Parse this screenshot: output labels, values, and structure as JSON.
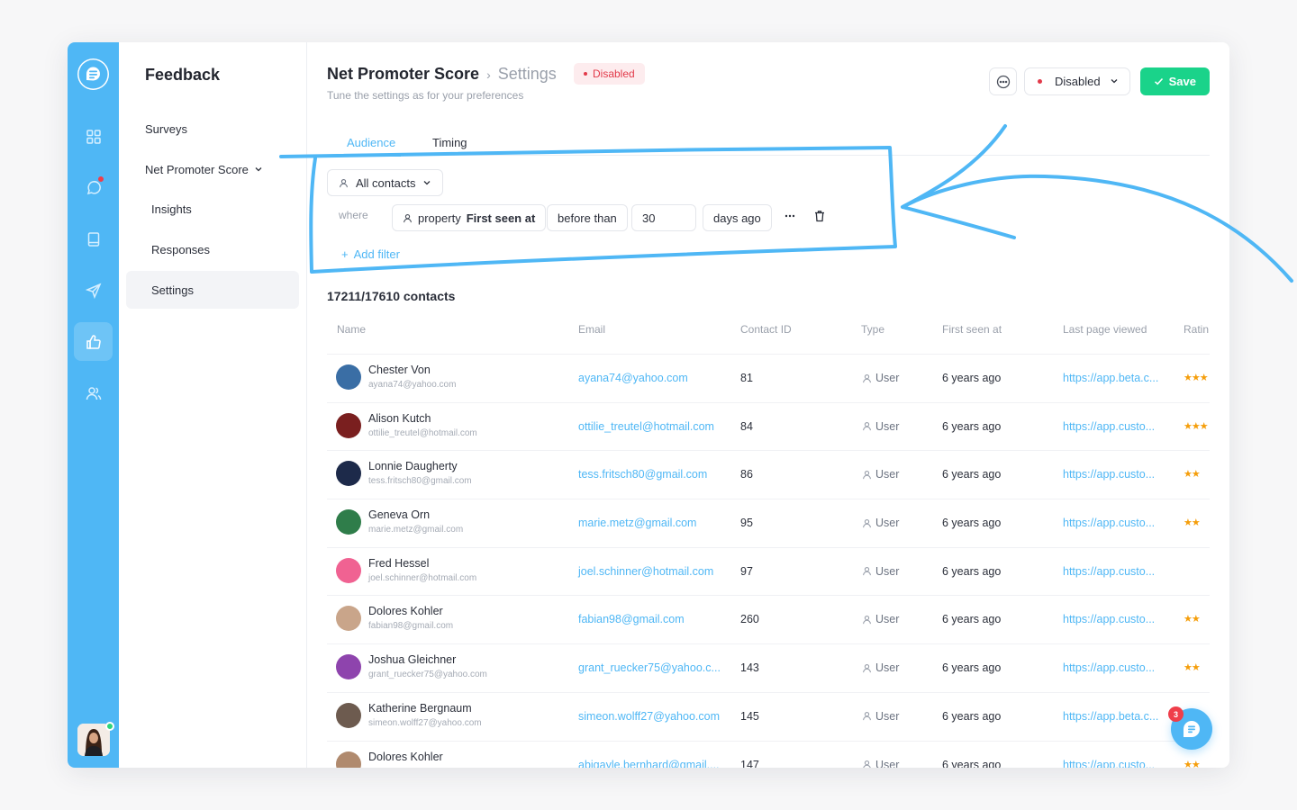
{
  "sidebar": {
    "title": "Feedback",
    "items": [
      {
        "label": "Surveys"
      },
      {
        "label": "Net Promoter Score"
      },
      {
        "label": "Insights"
      },
      {
        "label": "Responses"
      },
      {
        "label": "Settings"
      }
    ]
  },
  "header": {
    "breadcrumb_parent": "Net Promoter Score",
    "breadcrumb_current": "Settings",
    "status_badge": "Disabled",
    "subtitle": "Tune the settings as for your preferences",
    "status_select": "Disabled",
    "save_label": "Save"
  },
  "tabs": [
    {
      "label": "Audience"
    },
    {
      "label": "Timing"
    }
  ],
  "filters": {
    "audience": "All contacts",
    "where": "where",
    "property_prefix": "property",
    "property_name": "First seen at",
    "operator": "before than",
    "value": "30",
    "unit": "days ago",
    "add_filter": "Add filter"
  },
  "contacts_count": "17211/17610 contacts",
  "table": {
    "columns": [
      "Name",
      "Email",
      "Contact ID",
      "Type",
      "First seen at",
      "Last page viewed",
      "Ratin"
    ],
    "rows": [
      {
        "name": "Chester Von",
        "sub": "ayana74@yahoo.com",
        "email": "ayana74@yahoo.com",
        "id": "81",
        "type": "User",
        "seen": "6 years ago",
        "url": "https://app.beta.c...",
        "stars": "★★★"
      },
      {
        "name": "Alison Kutch",
        "sub": "ottilie_treutel@hotmail.com",
        "email": "ottilie_treutel@hotmail.com",
        "id": "84",
        "type": "User",
        "seen": "6 years ago",
        "url": "https://app.custo...",
        "stars": "★★★"
      },
      {
        "name": "Lonnie Daugherty",
        "sub": "tess.fritsch80@gmail.com",
        "email": "tess.fritsch80@gmail.com",
        "id": "86",
        "type": "User",
        "seen": "6 years ago",
        "url": "https://app.custo...",
        "stars": "★★"
      },
      {
        "name": "Geneva Orn",
        "sub": "marie.metz@gmail.com",
        "email": "marie.metz@gmail.com",
        "id": "95",
        "type": "User",
        "seen": "6 years ago",
        "url": "https://app.custo...",
        "stars": "★★"
      },
      {
        "name": "Fred Hessel",
        "sub": "joel.schinner@hotmail.com",
        "email": "joel.schinner@hotmail.com",
        "id": "97",
        "type": "User",
        "seen": "6 years ago",
        "url": "https://app.custo...",
        "stars": ""
      },
      {
        "name": "Dolores Kohler",
        "sub": "fabian98@gmail.com",
        "email": "fabian98@gmail.com",
        "id": "260",
        "type": "User",
        "seen": "6 years ago",
        "url": "https://app.custo...",
        "stars": "★★"
      },
      {
        "name": "Joshua Gleichner",
        "sub": "grant_ruecker75@yahoo.com",
        "email": "grant_ruecker75@yahoo.c...",
        "id": "143",
        "type": "User",
        "seen": "6 years ago",
        "url": "https://app.custo...",
        "stars": "★★"
      },
      {
        "name": "Katherine Bergnaum",
        "sub": "simeon.wolff27@yahoo.com",
        "email": "simeon.wolff27@yahoo.com",
        "id": "145",
        "type": "User",
        "seen": "6 years ago",
        "url": "https://app.beta.c...",
        "stars": ""
      },
      {
        "name": "Dolores Kohler",
        "sub": "",
        "email": "abigayle.bernhard@gmail....",
        "id": "147",
        "type": "User",
        "seen": "6 years ago",
        "url": "https://app.custo...",
        "stars": "★★"
      }
    ]
  },
  "chat_badge": "3",
  "colors": {
    "accent": "#4fb7f5",
    "save": "#1ad38a",
    "danger": "#e23a4a",
    "annotation": "#4fb7f5"
  }
}
